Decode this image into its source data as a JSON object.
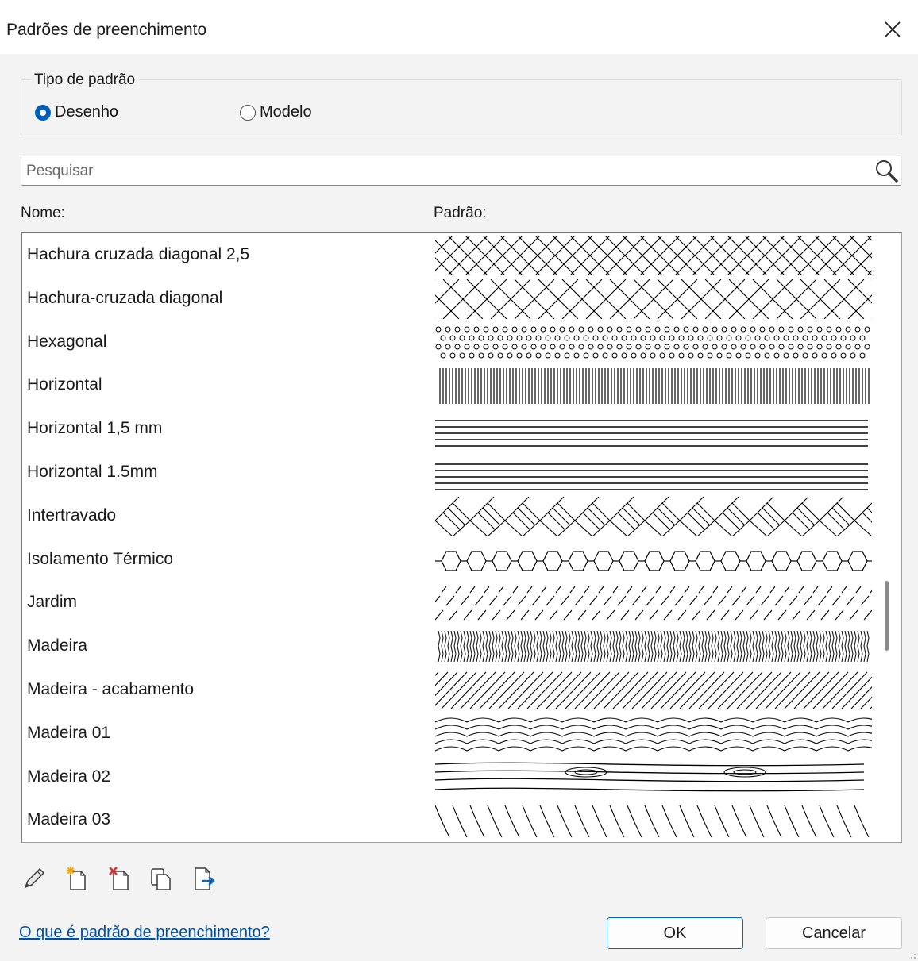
{
  "dialog": {
    "title": "Padrões de preenchimento"
  },
  "pattern_type": {
    "legend": "Tipo de padrão",
    "options": [
      {
        "label": "Desenho",
        "selected": true
      },
      {
        "label": "Modelo",
        "selected": false
      }
    ]
  },
  "search": {
    "placeholder": "Pesquisar",
    "value": ""
  },
  "columns": {
    "name": "Nome:",
    "pattern": "Padrão:"
  },
  "patterns": [
    {
      "name": "Hachura cruzada diagonal 2,5",
      "icon": "diagonal-crosshatch-fine"
    },
    {
      "name": "Hachura-cruzada diagonal",
      "icon": "diagonal-crosshatch"
    },
    {
      "name": "Hexagonal",
      "icon": "hexagonal-dots"
    },
    {
      "name": "Horizontal",
      "icon": "vertical-lines-dense"
    },
    {
      "name": "Horizontal 1,5 mm",
      "icon": "horizontal-lines"
    },
    {
      "name": "Horizontal 1.5mm",
      "icon": "horizontal-lines"
    },
    {
      "name": "Intertravado",
      "icon": "interlocking-pavers"
    },
    {
      "name": "Isolamento Térmico",
      "icon": "thermal-insulation"
    },
    {
      "name": "Jardim",
      "icon": "garden-dashes"
    },
    {
      "name": "Madeira",
      "icon": "wood-zigzag"
    },
    {
      "name": "Madeira - acabamento",
      "icon": "wood-finish-diagonals"
    },
    {
      "name": "Madeira 01",
      "icon": "wood-grain-waves"
    },
    {
      "name": "Madeira 02",
      "icon": "wood-grain-knots"
    },
    {
      "name": "Madeira 03",
      "icon": "wood-grain-strokes"
    }
  ],
  "toolbar": {
    "icons": [
      "edit-pencil-icon",
      "new-pattern-icon",
      "delete-pattern-icon",
      "duplicate-pattern-icon",
      "import-pattern-icon"
    ]
  },
  "footer": {
    "help_link": "O que é padrão de preenchimento?",
    "ok_label": "OK",
    "cancel_label": "Cancelar"
  },
  "colors": {
    "accent": "#005fb8",
    "link": "#0050a0",
    "client_bg": "#f3f3f3"
  }
}
